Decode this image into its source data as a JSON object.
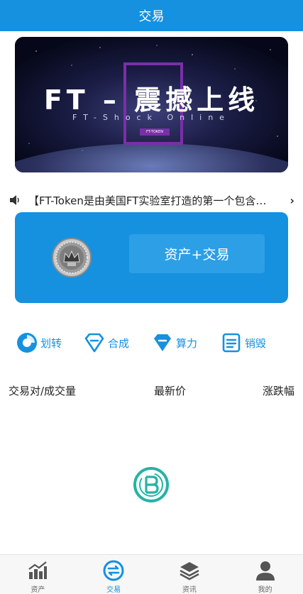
{
  "header": {
    "title": "交易"
  },
  "banner": {
    "title": "FT – 震撼上线",
    "subtitle": "FT-Shock Online",
    "tag": "FT-TOKEN"
  },
  "notice": {
    "text": "【FT-Token是由美国FT实验室打造的第一个包含…",
    "arrow": "›"
  },
  "asset_card": {
    "button_label": "资产+交易"
  },
  "quick_actions": [
    {
      "label": "划转",
      "icon": "transfer-icon"
    },
    {
      "label": "合成",
      "icon": "diamond-outline-icon"
    },
    {
      "label": "算力",
      "icon": "diamond-filled-icon"
    },
    {
      "label": "销毁",
      "icon": "list-icon"
    }
  ],
  "market": {
    "col_pair": "交易对/成交量",
    "col_price": "最新价",
    "col_change": "涨跌幅"
  },
  "tabbar": [
    {
      "label": "资产",
      "icon": "chart-icon",
      "active": false
    },
    {
      "label": "交易",
      "icon": "exchange-icon",
      "active": true
    },
    {
      "label": "资讯",
      "icon": "layers-icon",
      "active": false
    },
    {
      "label": "我的",
      "icon": "user-icon",
      "active": false
    }
  ],
  "colors": {
    "primary": "#1591df",
    "banner_frame": "#7a2fa8",
    "loader": "#26b3a4"
  }
}
